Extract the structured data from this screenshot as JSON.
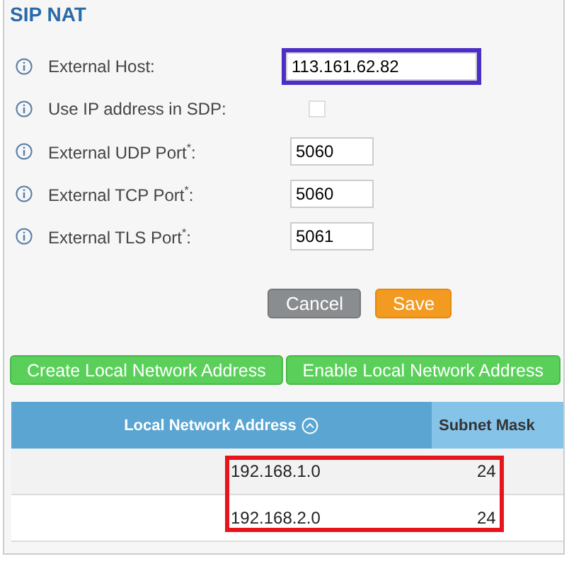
{
  "title": "SIP NAT",
  "fields": [
    {
      "kind": "text",
      "label": "External Host:",
      "value": "113.161.62.82",
      "wide": true,
      "highlighted": true
    },
    {
      "kind": "checkbox",
      "label": "Use IP address in SDP:",
      "checked": false
    },
    {
      "kind": "text",
      "label": "External UDP Port$^{*}$:",
      "value": "5060",
      "wide": false,
      "highlighted": false
    },
    {
      "kind": "text",
      "label": "External TCP Port$^{*}$:",
      "value": "5060",
      "wide": false,
      "highlighted": false
    },
    {
      "kind": "text",
      "label": "External TLS Port$^{*}$:",
      "value": "5061",
      "wide": false,
      "highlighted": false
    }
  ],
  "buttons": [
    {
      "kind": "cancel",
      "label": "Cancel"
    },
    {
      "kind": "save",
      "label": "Save"
    }
  ],
  "actions": [
    "Create Local Network Address",
    "Enable Local Network Address"
  ],
  "table": {
    "columns": [
      {
        "label": "Local Network Address",
        "sorted": true
      },
      {
        "label": "Subnet Mask",
        "sorted": false
      }
    ],
    "highlighted": true,
    "rows": [
      [
        "192.168.1.0",
        "24"
      ],
      [
        "192.168.2.0",
        "24"
      ]
    ]
  }
}
